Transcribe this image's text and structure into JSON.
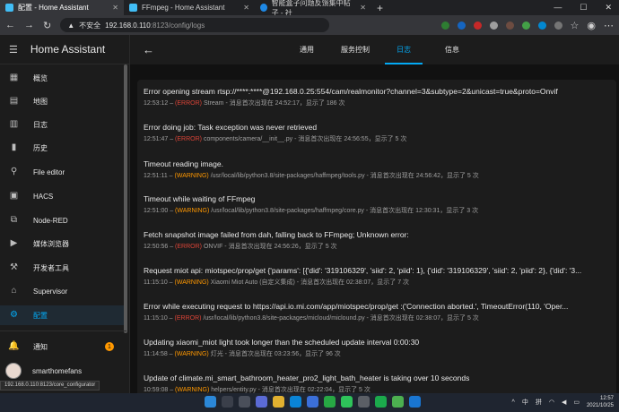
{
  "browser": {
    "tabs": [
      {
        "title": "配置 - Home Assistant",
        "active": true
      },
      {
        "title": "FFmpeg - Home Assistant",
        "active": false
      },
      {
        "title": "智能盒子问题反馈集中帖子 - 社",
        "active": false
      }
    ],
    "new_tab": "+",
    "address": {
      "security": "不安全",
      "host": "192.168.0.110",
      "path": ":8123/config/logs"
    }
  },
  "sidebar": {
    "title": "Home Assistant",
    "items": [
      {
        "label": "概览",
        "icon": "dashboard-icon",
        "glyph": "▦"
      },
      {
        "label": "地图",
        "icon": "map-icon",
        "glyph": "▤"
      },
      {
        "label": "日志",
        "icon": "logbook-icon",
        "glyph": "▥"
      },
      {
        "label": "历史",
        "icon": "history-icon",
        "glyph": "▮"
      },
      {
        "label": "File editor",
        "icon": "wrench-icon",
        "glyph": "🔧"
      },
      {
        "label": "HACS",
        "icon": "hacs-icon",
        "glyph": "▣"
      },
      {
        "label": "Node-RED",
        "icon": "sitemap-icon",
        "glyph": "⧉"
      },
      {
        "label": "媒体浏览器",
        "icon": "media-icon",
        "glyph": "▶"
      },
      {
        "label": "开发者工具",
        "icon": "hammer-icon",
        "glyph": "⚒"
      },
      {
        "label": "Supervisor",
        "icon": "supervisor-icon",
        "glyph": "⌂"
      },
      {
        "label": "配置",
        "icon": "gear-icon",
        "glyph": "⚙",
        "selected": true
      }
    ],
    "notifications": {
      "label": "通知",
      "count": "1"
    },
    "user": {
      "name": "smarthomefans"
    }
  },
  "status_url": "192.168.0.110:8123/core_configurator",
  "page": {
    "tabs": [
      {
        "label": "通用"
      },
      {
        "label": "服务控制"
      },
      {
        "label": "日志",
        "active": true
      },
      {
        "label": "信息"
      }
    ]
  },
  "logs": [
    {
      "message": "Error opening stream rtsp://****:****@192.168.0.25:554/cam/realmonitor?channel=3&subtype=2&unicast=true&proto=Onvif",
      "time": "12:53:12",
      "level": "(ERROR)",
      "source": "Stream - 消息首次出现在 24:52:17，显示了 186 次"
    },
    {
      "message": "Error doing job: Task exception was never retrieved",
      "time": "12:51:47",
      "level": "(ERROR)",
      "source": "components/camera/__init__.py - 消息首次出现在 24:56:55，显示了 5 次"
    },
    {
      "message": "Timeout reading image.",
      "time": "12:51:11",
      "level": "(WARNING)",
      "source": "/usr/local/lib/python3.8/site-packages/haffmpeg/tools.py - 消息首次出现在 24:56:42，显示了 5 次"
    },
    {
      "message": "Timeout while waiting of FFmpeg",
      "time": "12:51:00",
      "level": "(WARNING)",
      "source": "/usr/local/lib/python3.8/site-packages/haffmpeg/core.py - 消息首次出现在 12:30:31，显示了 3 次"
    },
    {
      "message": "Fetch snapshot image failed from dah, falling back to FFmpeg; Unknown error:",
      "time": "12:50:56",
      "level": "(ERROR)",
      "source": "ONVIF - 消息首次出现在 24:56:26，显示了 5 次"
    },
    {
      "message": "Request miot api: miotspec/prop/get {'params': [{'did': '319106329', 'siid': 2, 'piid': 1}, {'did': '319106329', 'siid': 2, 'piid': 2}, {'did': '3...",
      "time": "11:15:10",
      "level": "(WARNING)",
      "source": "Xiaomi Miot Auto (自定义集成) - 消息首次出现在 02:38:07，显示了 7 次"
    },
    {
      "message": "Error while executing request to https://api.io.mi.com/app/miotspec/prop/get :('Connection aborted.', TimeoutError(110, 'Oper...",
      "time": "11:15:10",
      "level": "(ERROR)",
      "source": "/usr/local/lib/python3.8/site-packages/micloud/miclound.py - 消息首次出现在 02:38:07，显示了 5 次"
    },
    {
      "message": "Updating xiaomi_miot light took longer than the scheduled update interval 0:00:30",
      "time": "11:14:58",
      "level": "(WARNING)",
      "source": "灯光 - 消息首次出现在 03:23:56，显示了 96 次"
    },
    {
      "message": "Update of climate.mi_smart_bathroom_heater_pro2_light_bath_heater is taking over 10 seconds",
      "time": "10:59:08",
      "level": "(WARNING)",
      "source": "helpers/entity.py - 消息首次出现在 02:22:04，显示了 5 次"
    }
  ],
  "taskbar": {
    "ime": "拼",
    "lang": "中",
    "time": "12:57",
    "date": "2021/10/25"
  },
  "colors": {
    "accent": "#03a9f4",
    "error": "#db4437",
    "warning": "#ff9800"
  }
}
